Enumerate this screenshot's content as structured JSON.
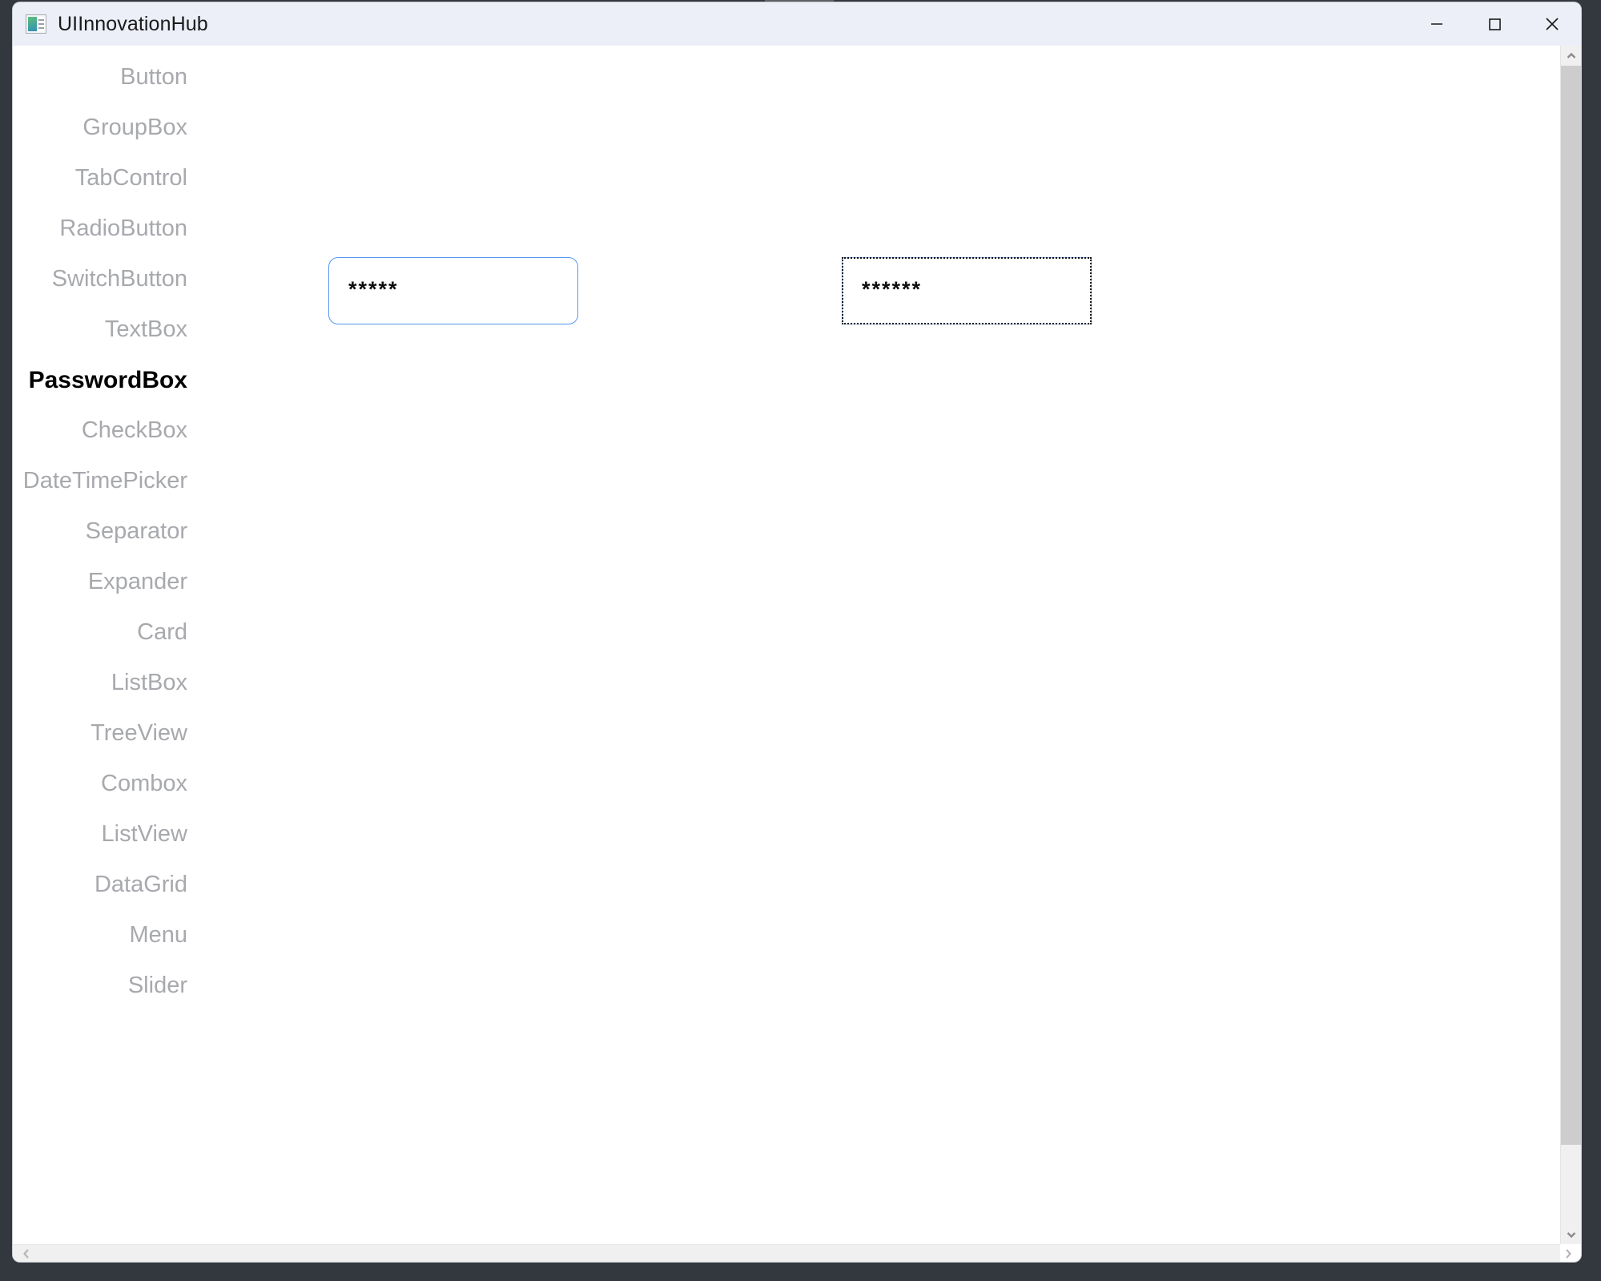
{
  "window": {
    "title": "UIInnovationHub",
    "icon": "app-window-icon",
    "controls": [
      {
        "name": "minimize",
        "glyph": "—"
      },
      {
        "name": "maximize",
        "glyph": "□"
      },
      {
        "name": "close",
        "glyph": "✕"
      }
    ]
  },
  "desktop": {
    "drag_badge": "window-drag-handle"
  },
  "nav": {
    "selected": "PasswordBox",
    "items": [
      {
        "label": "Button",
        "selected": false
      },
      {
        "label": "GroupBox",
        "selected": false
      },
      {
        "label": "TabControl",
        "selected": false
      },
      {
        "label": "RadioButton",
        "selected": false
      },
      {
        "label": "SwitchButton",
        "selected": false
      },
      {
        "label": "TextBox",
        "selected": false
      },
      {
        "label": "PasswordBox",
        "selected": true
      },
      {
        "label": "CheckBox",
        "selected": false
      },
      {
        "label": "DateTimePicker",
        "selected": false
      },
      {
        "label": "Separator",
        "selected": false
      },
      {
        "label": "Expander",
        "selected": false
      },
      {
        "label": "Card",
        "selected": false
      },
      {
        "label": "ListBox",
        "selected": false
      },
      {
        "label": "TreeView",
        "selected": false
      },
      {
        "label": "Combox",
        "selected": false
      },
      {
        "label": "ListView",
        "selected": false
      },
      {
        "label": "DataGrid",
        "selected": false
      },
      {
        "label": "Menu",
        "selected": false
      },
      {
        "label": "Slider",
        "selected": false
      }
    ]
  },
  "content": {
    "password_primary": {
      "value": "*****",
      "char_count": 5,
      "border_color": "#5596f0",
      "style": "rounded"
    },
    "password_secondary": {
      "value": "******",
      "char_count": 6,
      "border_color": "#94baf2",
      "focus_outline_color": "#141414",
      "style": "dotted-focus"
    }
  },
  "scrollbars": {
    "vertical": {
      "up_icon": "chevron-up-icon",
      "down_icon": "chevron-down-icon",
      "thumb": "vertical-scroll-thumb"
    },
    "horizontal": {
      "left_icon": "chevron-left-icon",
      "right_icon": "chevron-right-icon"
    }
  },
  "colors": {
    "titlebar_bg": "#eceff8",
    "desktop_bg": "#33383e",
    "nav_text": "#a7a9ad",
    "nav_selected_text": "#000000",
    "accent": "#5596f0"
  }
}
